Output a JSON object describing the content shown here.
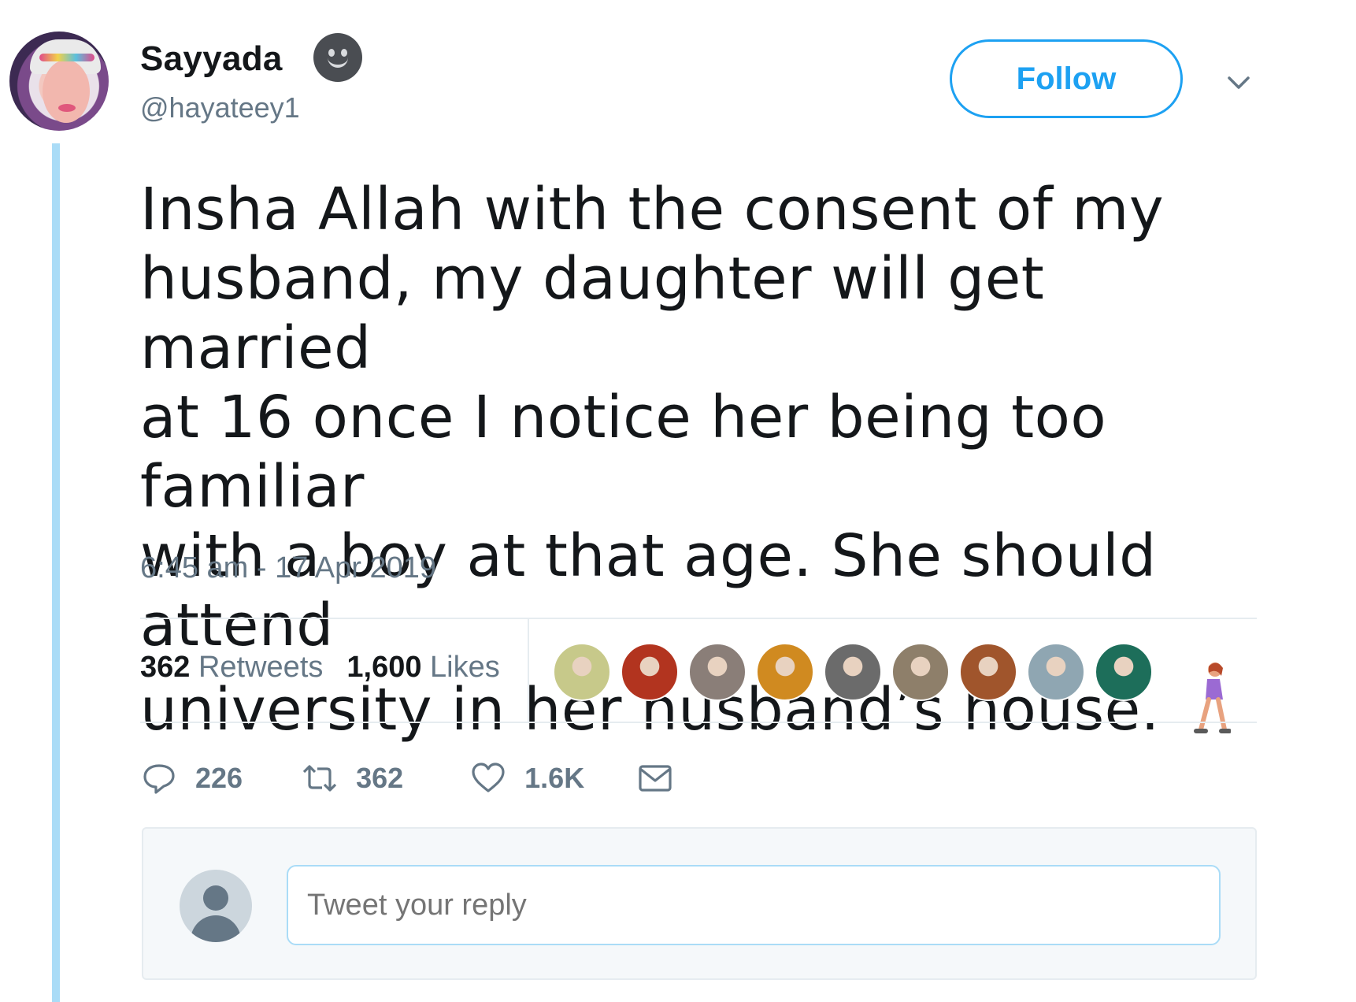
{
  "author": {
    "name": "Sayyada",
    "handle": "@hayateey1",
    "name_emoji": "neutral-face-emoji"
  },
  "header": {
    "follow_label": "Follow",
    "menu_icon": "chevron-down-icon"
  },
  "tweet": {
    "lines": [
      "Insha Allah with the consent of my",
      "husband, my daughter will get married",
      "at 16 once I notice her being too familiar",
      "with a boy at that age. She should attend",
      "university in her husband’s house."
    ],
    "trailing_emoji": "woman-walking-emoji",
    "timestamp": "6:45 am - 17 Apr 2019"
  },
  "stats": {
    "retweets_count": "362",
    "retweets_label": "Retweets",
    "likes_count": "1,600",
    "likes_label": "Likes",
    "liker_avatar_colors": [
      "#c7c98a",
      "#b2341f",
      "#8a7e78",
      "#d08a20",
      "#6b6b6b",
      "#8e7f6a",
      "#a0552c",
      "#8fa6b2",
      "#1d6e5a"
    ]
  },
  "actions": {
    "reply_count": "226",
    "retweet_count": "362",
    "like_count": "1.6K",
    "icons": [
      "reply-icon",
      "retweet-icon",
      "like-icon",
      "direct-message-icon"
    ]
  },
  "reply": {
    "placeholder": "Tweet your reply"
  },
  "colors": {
    "accent": "#1da1f2",
    "thread_line": "#aadcf7",
    "secondary_text": "#657786"
  }
}
